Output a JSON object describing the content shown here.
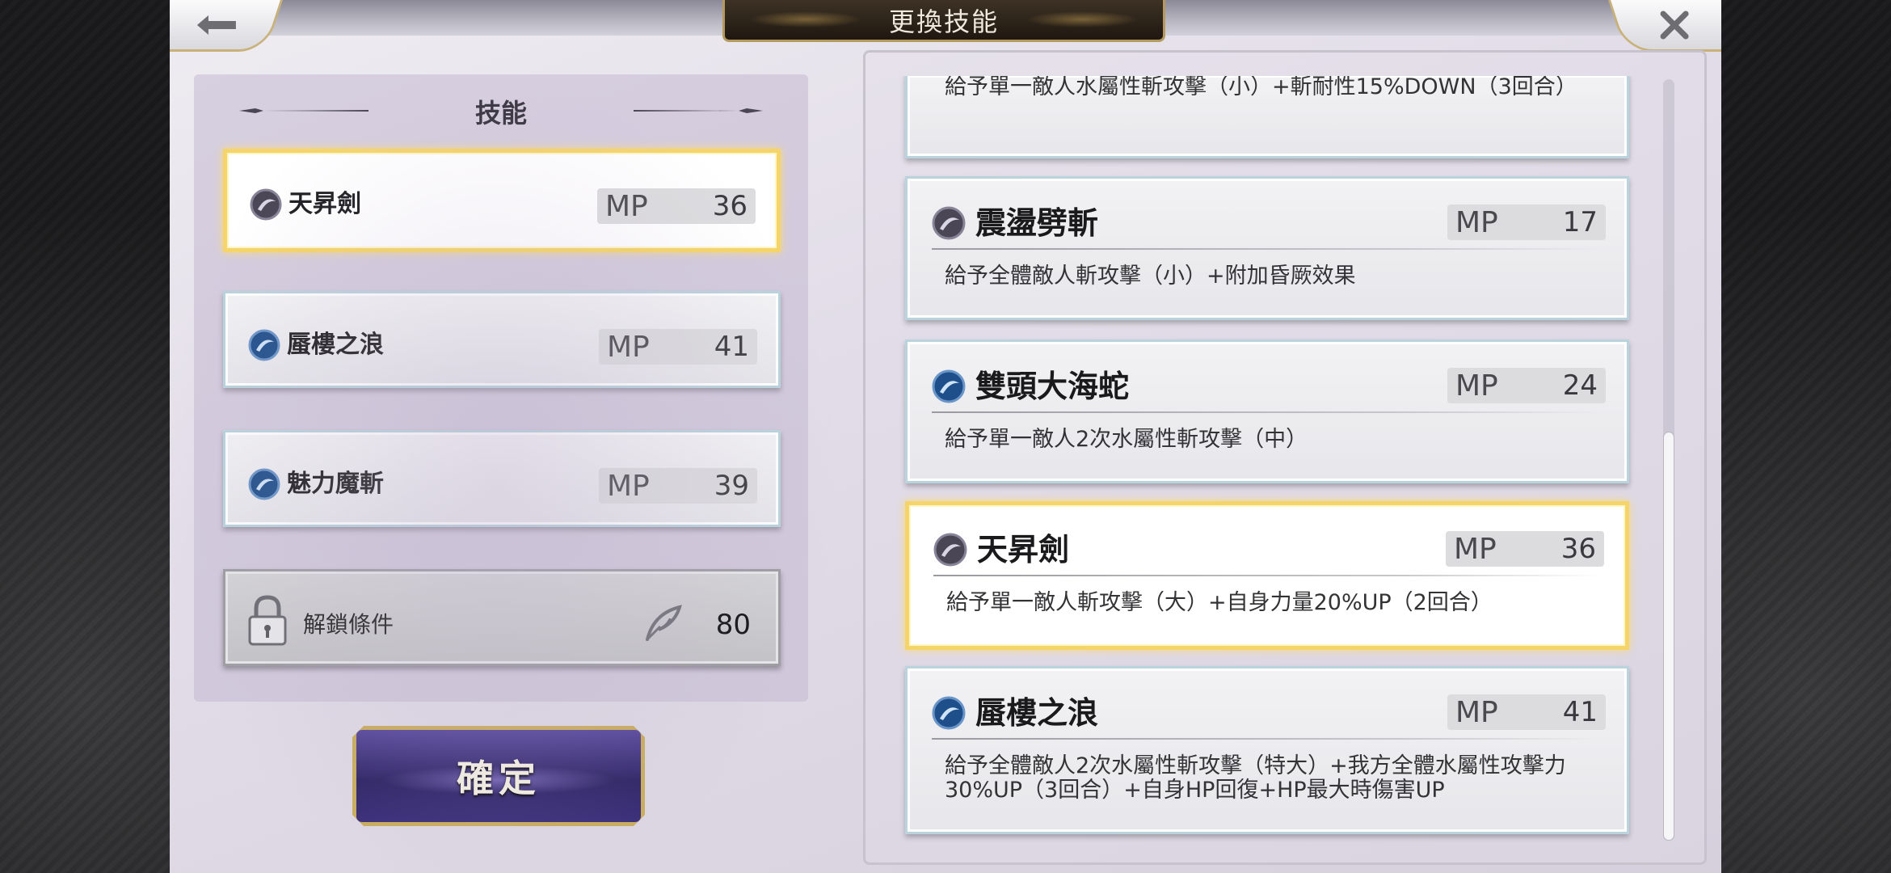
{
  "header": {
    "title": "更換技能",
    "back_icon": "back-arrow-icon",
    "close_icon": "close-icon"
  },
  "left_panel": {
    "title": "技能",
    "slots": [
      {
        "name": "天昇劍",
        "mp_label": "MP",
        "mp": "36",
        "selected": true,
        "icon": "dark-orb-icon"
      },
      {
        "name": "蜃樓之浪",
        "mp_label": "MP",
        "mp": "41",
        "selected": false,
        "icon": "water-orb-icon"
      },
      {
        "name": "魅力魔斬",
        "mp_label": "MP",
        "mp": "39",
        "selected": false,
        "icon": "water-orb-icon"
      }
    ],
    "lock_slot": {
      "label": "解鎖條件",
      "icon": "feather-icon",
      "value": "80"
    },
    "confirm_label": "確定"
  },
  "skill_list": [
    {
      "name": "",
      "mp_label": "",
      "mp": "",
      "desc": "給予單一敵人水屬性斬攻擊（小）+斬耐性15%DOWN（3回合）",
      "partial": true
    },
    {
      "name": "震盪劈斬",
      "mp_label": "MP",
      "mp": "17",
      "desc": "給予全體敵人斬攻擊（小）+附加昏厥效果",
      "icon": "dark-orb-icon"
    },
    {
      "name": "雙頭大海蛇",
      "mp_label": "MP",
      "mp": "24",
      "desc": "給予單一敵人2次水屬性斬攻擊（中）",
      "icon": "water-orb-icon"
    },
    {
      "name": "天昇劍",
      "mp_label": "MP",
      "mp": "36",
      "desc": "給予單一敵人斬攻擊（大）+自身力量20%UP（2回合）",
      "selected": true,
      "icon": "dark-orb-icon"
    },
    {
      "name": "蜃樓之浪",
      "mp_label": "MP",
      "mp": "41",
      "desc": "給予全體敵人2次水屬性斬攻擊（特大）+我方全體水屬性攻擊力30%UP（3回合）+自身HP回復+HP最大時傷害UP",
      "icon": "water-orb-icon"
    }
  ],
  "colors": {
    "selected_border": "#f5d56a",
    "card_border": "#b9d4dd",
    "confirm_bg": "#2e2464",
    "confirm_border": "#c9ad5e"
  }
}
